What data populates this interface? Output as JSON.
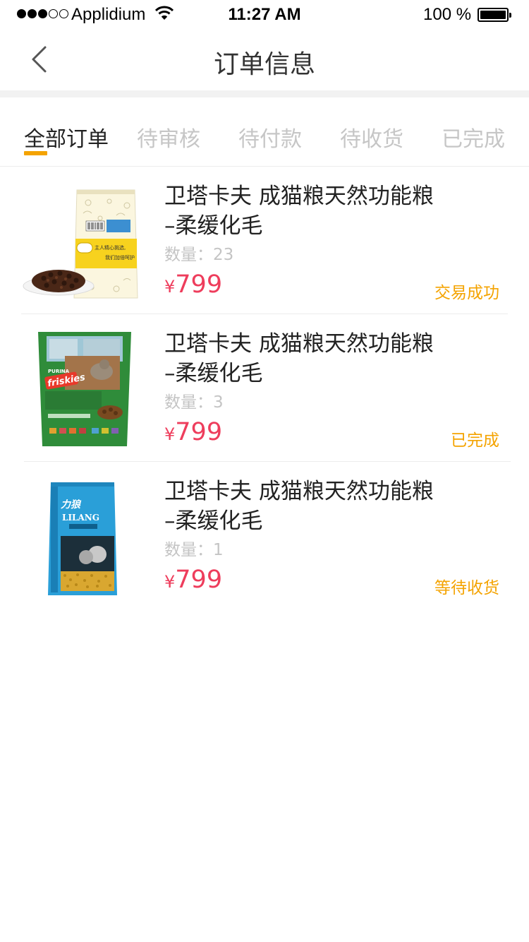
{
  "status_bar": {
    "carrier": "Applidium",
    "time": "11:27 AM",
    "battery_percent": "100 %"
  },
  "nav": {
    "title": "订单信息",
    "back_icon": "chevron-left-icon"
  },
  "tabs": [
    {
      "label": "全部订单",
      "active": true
    },
    {
      "label": "待审核",
      "active": false
    },
    {
      "label": "待付款",
      "active": false
    },
    {
      "label": "待收货",
      "active": false
    },
    {
      "label": "已完成",
      "active": false
    }
  ],
  "colors": {
    "accent": "#f4a300",
    "price": "#ee3d5c",
    "muted": "#c4c4c4"
  },
  "orders": [
    {
      "title_line1": "卫塔卡夫 成猫粮天然功能粮",
      "title_line2": "–柔缓化毛",
      "qty_label": "数量：",
      "qty": "23",
      "currency": "¥",
      "price": "799",
      "status": "交易成功",
      "image_icon": "cat-food-bag-yellow",
      "image_text": "主人精心挑选，我们加倍呵护"
    },
    {
      "title_line1": "卫塔卡夫 成猫粮天然功能粮",
      "title_line2": "–柔缓化毛",
      "qty_label": "数量：",
      "qty": "3",
      "currency": "¥",
      "price": "799",
      "status": "已完成",
      "image_icon": "cat-food-bag-green",
      "image_brand_top": "PURINA",
      "image_brand": "friskies"
    },
    {
      "title_line1": "卫塔卡夫 成猫粮天然功能粮",
      "title_line2": "–柔缓化毛",
      "qty_label": "数量：",
      "qty": "1",
      "currency": "¥",
      "price": "799",
      "status": "等待收货",
      "image_icon": "cat-food-bag-blue",
      "image_brand_cn": "力狼",
      "image_brand": "LILANG"
    }
  ]
}
